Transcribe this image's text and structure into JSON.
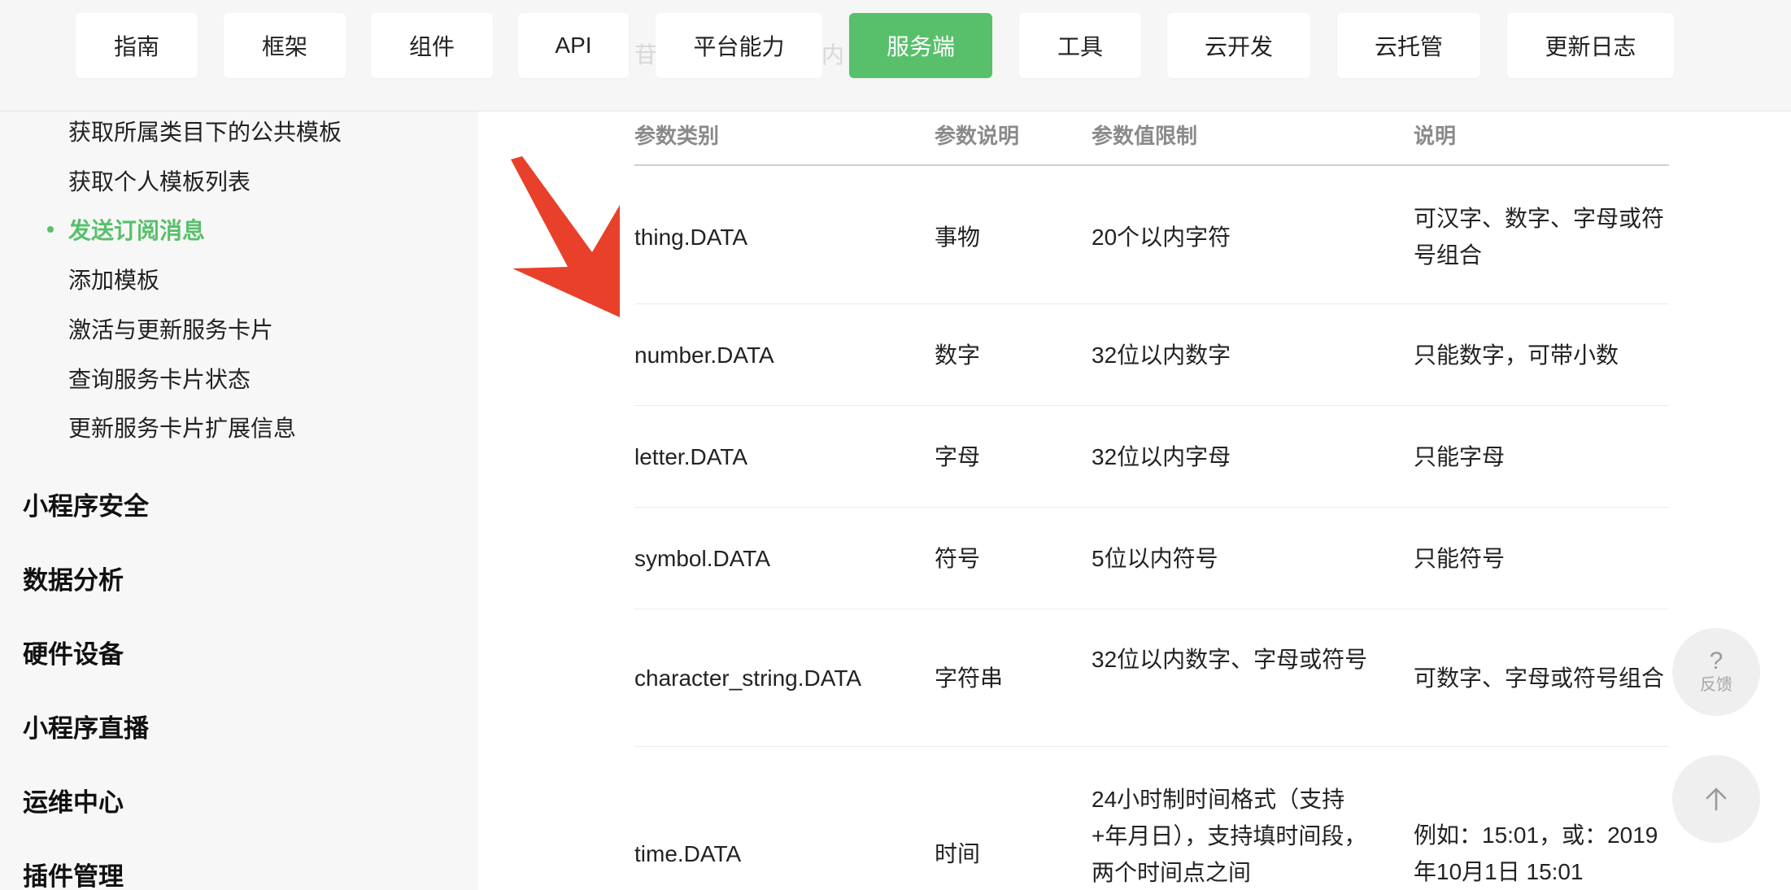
{
  "nav": {
    "items": [
      {
        "label": "指南"
      },
      {
        "label": "框架"
      },
      {
        "label": "组件"
      },
      {
        "label": "API"
      },
      {
        "label": "平台能力"
      },
      {
        "label": "服务端"
      },
      {
        "label": "工具"
      },
      {
        "label": "云开发"
      },
      {
        "label": "云托管"
      },
      {
        "label": "更新日志"
      }
    ],
    "active_label": "服务端",
    "accent_color": "#58c06b"
  },
  "sidebar": {
    "sub_items": [
      {
        "label": "获取所属类目下的公共模板"
      },
      {
        "label": "获取个人模板列表"
      },
      {
        "label": "发送订阅消息",
        "active": true
      },
      {
        "label": "添加模板"
      },
      {
        "label": "激活与更新服务卡片"
      },
      {
        "label": "查询服务卡片状态"
      },
      {
        "label": "更新服务卡片扩展信息"
      }
    ],
    "sections": [
      {
        "label": "小程序安全"
      },
      {
        "label": "数据分析"
      },
      {
        "label": "硬件设备"
      },
      {
        "label": "小程序直播"
      },
      {
        "label": "运维中心"
      },
      {
        "label": "插件管理"
      }
    ]
  },
  "table": {
    "headers": [
      "参数类别",
      "参数说明",
      "参数值限制",
      "说明"
    ],
    "rows": [
      {
        "type": "thing.DATA",
        "desc": "事物",
        "limit": "20个以内字符",
        "note": "可汉字、数字、字母或符号组合"
      },
      {
        "type": "number.DATA",
        "desc": "数字",
        "limit": "32位以内数字",
        "note": "只能数字，可带小数"
      },
      {
        "type": "letter.DATA",
        "desc": "字母",
        "limit": "32位以内字母",
        "note": "只能字母"
      },
      {
        "type": "symbol.DATA",
        "desc": "符号",
        "limit": "5位以内符号",
        "note": "只能符号"
      },
      {
        "type": "character_string.DATA",
        "desc": "字符串",
        "limit": "32位以内数字、字母或符号",
        "note": "可数字、字母或符号组合"
      },
      {
        "type": "time.DATA",
        "desc": "时间",
        "limit": "24小时制时间格式（支持+年月日），支持填时间段，两个时间点之间",
        "note": "例如：15:01，或：2019年10月1日 15:01"
      }
    ]
  },
  "annotation": {
    "arrow_color": "#e8402a",
    "arrow_icon": "red-arrow-pointer"
  },
  "floating": {
    "feedback_label": "反馈",
    "feedback_icon": "?",
    "back_to_top_icon": "arrow-up"
  }
}
